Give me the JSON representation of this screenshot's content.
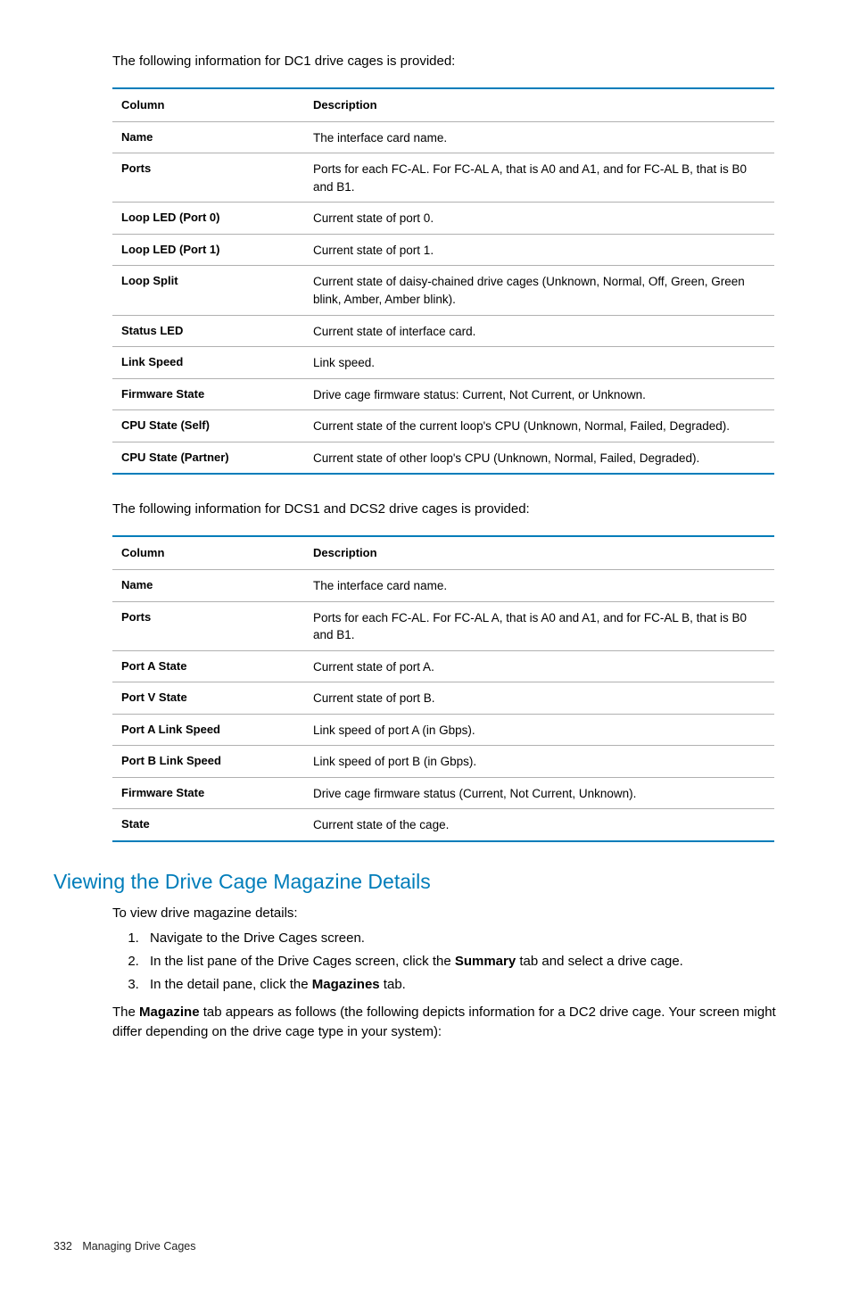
{
  "intro1": "The following information for DC1 drive cages is provided:",
  "table1": {
    "headers": {
      "col": "Column",
      "desc": "Description"
    },
    "rows": [
      {
        "col": "Name",
        "desc": "The interface card name."
      },
      {
        "col": "Ports",
        "desc": "Ports for each FC-AL. For FC-AL A, that is A0 and A1, and for FC-AL B, that is B0 and B1."
      },
      {
        "col": "Loop LED (Port 0)",
        "desc": "Current state of port 0."
      },
      {
        "col": "Loop LED (Port 1)",
        "desc": "Current state of port 1."
      },
      {
        "col": "Loop Split",
        "desc": "Current state of daisy-chained drive cages (Unknown, Normal, Off, Green, Green blink, Amber, Amber blink)."
      },
      {
        "col": "Status LED",
        "desc": "Current state of interface card."
      },
      {
        "col": "Link Speed",
        "desc": "Link speed."
      },
      {
        "col": "Firmware State",
        "desc": "Drive cage firmware status: Current, Not Current, or Unknown."
      },
      {
        "col": "CPU State (Self)",
        "desc": "Current state of the current loop's CPU (Unknown, Normal, Failed, Degraded)."
      },
      {
        "col": "CPU State (Partner)",
        "desc": "Current state of other loop's CPU (Unknown, Normal, Failed, Degraded)."
      }
    ]
  },
  "intro2": "The following information for DCS1 and DCS2 drive cages is provided:",
  "table2": {
    "headers": {
      "col": "Column",
      "desc": "Description"
    },
    "rows": [
      {
        "col": "Name",
        "desc": "The interface card name."
      },
      {
        "col": "Ports",
        "desc": "Ports for each FC-AL. For FC-AL A, that is A0 and A1, and for FC-AL B, that is B0 and B1."
      },
      {
        "col": "Port A State",
        "desc": "Current state of port A."
      },
      {
        "col": "Port V State",
        "desc": "Current state of port B."
      },
      {
        "col": "Port A Link Speed",
        "desc": "Link speed of port A (in Gbps)."
      },
      {
        "col": "Port B Link Speed",
        "desc": "Link speed of port B (in Gbps)."
      },
      {
        "col": "Firmware State",
        "desc": "Drive cage firmware status (Current, Not Current, Unknown)."
      },
      {
        "col": "State",
        "desc": "Current state of the cage."
      }
    ]
  },
  "section_heading": "Viewing the Drive Cage Magazine Details",
  "body1": "To view drive magazine details:",
  "steps": {
    "s1": "Navigate to the Drive Cages screen.",
    "s2a": "In the list pane of the Drive Cages screen, click the ",
    "s2b": "Summary",
    "s2c": " tab and select a drive cage.",
    "s3a": "In the detail pane, click the ",
    "s3b": "Magazines",
    "s3c": " tab."
  },
  "body2a": "The ",
  "body2b": "Magazine",
  "body2c": " tab appears as follows (the following depicts information for a DC2 drive cage. Your screen might differ depending on the drive cage type in your system):",
  "footer": {
    "page": "332",
    "title": "Managing Drive Cages"
  }
}
